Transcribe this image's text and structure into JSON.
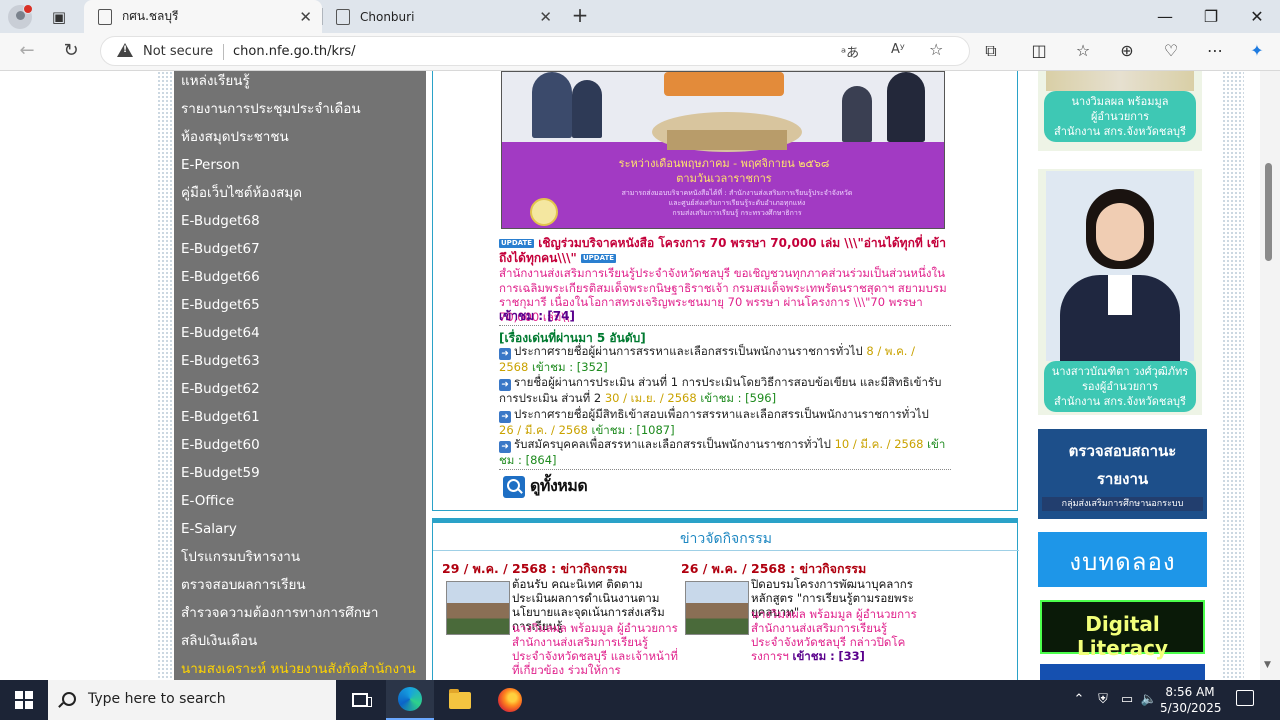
{
  "browser": {
    "tabs": [
      {
        "label": "กศน.ชลบุรี",
        "active": true
      },
      {
        "label": "Chonburi",
        "active": false
      }
    ],
    "security_label": "Not secure",
    "url": "chon.nfe.go.th/krs/",
    "window_controls": [
      "minimize",
      "restore",
      "close"
    ]
  },
  "sidebar": {
    "items": [
      "แหล่งเรียนรู้",
      "รายงานการประชุมประจำเดือน",
      "ห้องสมุดประชาชน",
      "E-Person",
      "คู่มือเว็บไซต์ห้องสมุด",
      "E-Budget68",
      "E-Budget67",
      "E-Budget66",
      "E-Budget65",
      "E-Budget64",
      "E-Budget63",
      "E-Budget62",
      "E-Budget61",
      "E-Budget60",
      "E-Budget59",
      "E-Office",
      "E-Salary",
      "โปรแกรมบริหารงาน",
      "ตรวจสอบผลการเรียน",
      "สำรวจความต้องการทางการศึกษา",
      "สลิปเงินเดือน",
      "นามสงเคราะห์ หน่วยงานสังกัดสำนักงาน"
    ]
  },
  "news": {
    "banner": {
      "line1": "ระหว่างเดือนพฤษภาคม - พฤศจิกายน ๒๕๖๘",
      "line2": "ตามวันเวลาราชการ",
      "small1": "สามารถส่งมอบบริจาคหนังสือได้ที่ : สำนักงานส่งเสริมการเรียนรู้ประจำจังหวัด",
      "small2": "และศูนย์ส่งเสริมการเรียนรู้ระดับอำเภอทุกแห่ง",
      "small3": "กรมส่งเสริมการเรียนรู้ กระทรวงศึกษาธิการ"
    },
    "update_badge": "UPDATE",
    "headline": "เชิญร่วมบริจาคหนังสือ โครงการ 70 พรรษา 70,000 เล่ม \\\\\\\"อ่านได้ทุกที่ เข้าถึงได้ทุกคน\\\\\\\"",
    "description": "สำนักงานส่งเสริมการเรียนรู้ประจำจังหวัดชลบุรี ขอเชิญชวนทุกภาคส่วนร่วมเป็นส่วนหนึ่งในการเฉลิมพระเกียรติสมเด็จพระกนิษฐาธิราชเจ้า กรมสมเด็จพระเทพรัตนราชสุดาฯ สยามบรมราชกุมารี เนื่องในโอกาสทรงเจริญพระชนมายุ 70 พรรษา ผ่านโครงการ \\\\\\\"70 พรรษา 70,000 เล่ม\\\\",
    "views_label": "เข้าชม :",
    "views_value": "[74]",
    "previous_heading": "[เรื่องเด่นที่ผ่านมา 5 อันดับ]",
    "announcements": [
      {
        "text": "ประกาศรายชื่อผู้ผ่านการสรรหาและเลือกสรรเป็นพนักงานราชการทั่วไป",
        "date": "8 / พ.ค. / 2568",
        "views_label": "เข้าชม :",
        "views": "[352]"
      },
      {
        "text": "รายชื่อผู้ผ่านการประเมิน ส่วนที่ 1 การประเมินโดยวิธีการสอบข้อเขียน และมีสิทธิเข้ารับการประเมิน ส่วนที่ 2",
        "date": "30 / เม.ย. / 2568",
        "views_label": "เข้าชม :",
        "views": "[596]"
      },
      {
        "text": "ประกาศรายชื่อผู้มีสิทธิเข้าสอบเพื่อการสรรหาและเลือกสรรเป็นพนักงานราชการทั่วไป",
        "date": "26 / มี.ค. / 2568",
        "views_label": "เข้าชม :",
        "views": "[1087]"
      },
      {
        "text": "รับสมัครบุคคลเพื่อสรรหาและเลือกสรรเป็นพนักงานราชการทั่วไป",
        "date": "10 / มี.ค. / 2568",
        "views_label": "เข้าชม :",
        "views": "[864]"
      }
    ],
    "view_all": "ดูทั้งหมด"
  },
  "activities": {
    "title": "ข่าวจัดกิจกรรม",
    "items": [
      {
        "date": "29 / พ.ค. / 2568 : ข่าวกิจกรรม",
        "headline": "ต้อนรับ คณะนิเทศ ติดตามประเมินผลการดำเนินงานตามนโยบายและจุดเน้นการส่งเสริมการเรียนรู้",
        "sub": "นางวิมลผล พร้อมมูล ผู้อำนวยการสำนักงานส่งเสริมการเรียนรู้ประจำจังหวัดชลบุรี และเจ้าหน้าที่ที่เกี่ยวข้อง ร่วมให้การ"
      },
      {
        "date": "26 / พ.ค. / 2568 : ข่าวกิจกรรม",
        "headline": "ปิดอบรมโครงการพัฒนาบุคลากร หลักสูตร \"การเรียนรู้ตามรอยพระยุคลบาท\"",
        "sub": "นางวิมลผล พร้อมมูล ผู้อำนวยการสำนักงานส่งเสริมการเรียนรู้ประจำจังหวัดชลบุรี กล่าวปิดโครงการฯ",
        "views_label": "เข้าชม :",
        "views": "[33]"
      }
    ]
  },
  "right": {
    "person1_caption": [
      "นางวิมลผล พร้อมมูล",
      "ผู้อำนวยการ",
      "สำนักงาน สกร.จังหวัดชลบุรี"
    ],
    "person2_caption": [
      "นางสาวบัณฑิตา วงศ์วุฒิภัทร",
      "รองผู้อำนวยการ",
      "สำนักงาน สกร.จังหวัดชลบุรี"
    ],
    "promo1": [
      "ตรวจสอบสถานะ",
      "รายงาน",
      "กลุ่มส่งเสริมการศึกษานอกระบบ"
    ],
    "promo2": "งบทดลอง",
    "promo3": "Digital Literacy"
  },
  "taskbar": {
    "search_placeholder": "Type here to search",
    "time": "8:56 AM",
    "date": "5/30/2025"
  },
  "colors": {
    "sidebar_bg": "#737373",
    "frame_accent": "#2aa2c8",
    "headline": "#c4003a",
    "caption_bg": "#3ec8b4"
  }
}
